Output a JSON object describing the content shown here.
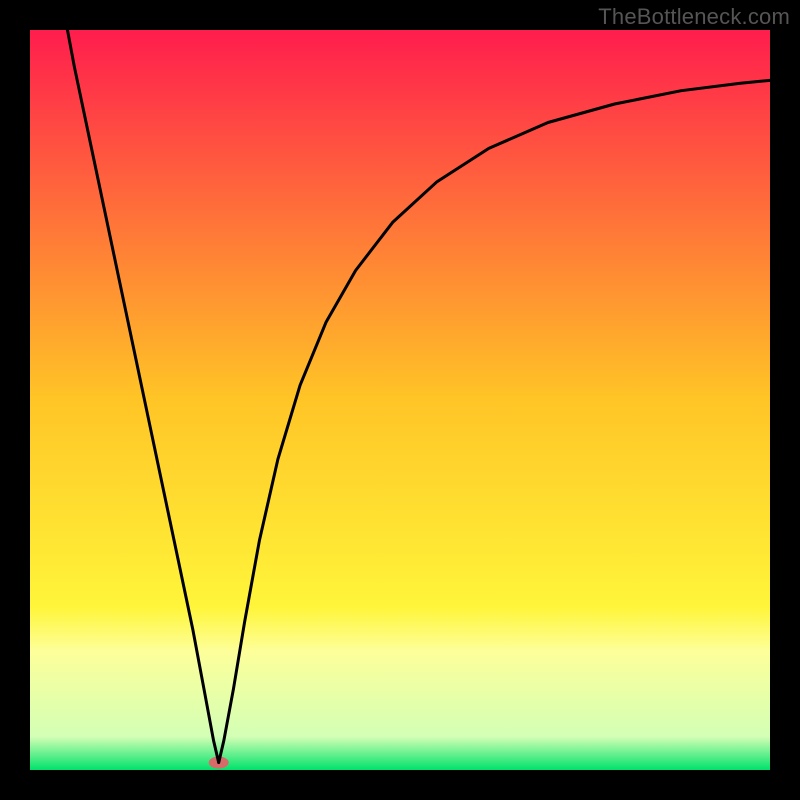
{
  "watermark": "TheBottleneck.com",
  "chart_data": {
    "type": "line",
    "title": "",
    "xlabel": "",
    "ylabel": "",
    "xlim": [
      0,
      1
    ],
    "ylim": [
      0,
      1
    ],
    "background_gradient": {
      "stops": [
        {
          "offset": 0.0,
          "color": "#ff1d4d"
        },
        {
          "offset": 0.5,
          "color": "#ffc526"
        },
        {
          "offset": 0.78,
          "color": "#fff53a"
        },
        {
          "offset": 0.84,
          "color": "#fdff9a"
        },
        {
          "offset": 0.955,
          "color": "#d3ffb5"
        },
        {
          "offset": 1.0,
          "color": "#00e26b"
        }
      ]
    },
    "minimum_marker": {
      "x": 0.255,
      "y": 0.01,
      "color": "#d96a6a",
      "rx": 10,
      "ry": 6
    },
    "series": [
      {
        "name": "curve",
        "stroke": "#000000",
        "stroke_width": 3,
        "points": [
          {
            "x": 0.045,
            "y": 1.03
          },
          {
            "x": 0.06,
            "y": 0.95
          },
          {
            "x": 0.08,
            "y": 0.855
          },
          {
            "x": 0.1,
            "y": 0.76
          },
          {
            "x": 0.12,
            "y": 0.665
          },
          {
            "x": 0.14,
            "y": 0.57
          },
          {
            "x": 0.16,
            "y": 0.475
          },
          {
            "x": 0.18,
            "y": 0.38
          },
          {
            "x": 0.2,
            "y": 0.285
          },
          {
            "x": 0.22,
            "y": 0.19
          },
          {
            "x": 0.235,
            "y": 0.11
          },
          {
            "x": 0.248,
            "y": 0.04
          },
          {
            "x": 0.255,
            "y": 0.01
          },
          {
            "x": 0.262,
            "y": 0.04
          },
          {
            "x": 0.275,
            "y": 0.11
          },
          {
            "x": 0.29,
            "y": 0.2
          },
          {
            "x": 0.31,
            "y": 0.31
          },
          {
            "x": 0.335,
            "y": 0.42
          },
          {
            "x": 0.365,
            "y": 0.52
          },
          {
            "x": 0.4,
            "y": 0.605
          },
          {
            "x": 0.44,
            "y": 0.675
          },
          {
            "x": 0.49,
            "y": 0.74
          },
          {
            "x": 0.55,
            "y": 0.795
          },
          {
            "x": 0.62,
            "y": 0.84
          },
          {
            "x": 0.7,
            "y": 0.875
          },
          {
            "x": 0.79,
            "y": 0.9
          },
          {
            "x": 0.88,
            "y": 0.918
          },
          {
            "x": 0.96,
            "y": 0.928
          },
          {
            "x": 1.0,
            "y": 0.932
          }
        ]
      }
    ]
  }
}
